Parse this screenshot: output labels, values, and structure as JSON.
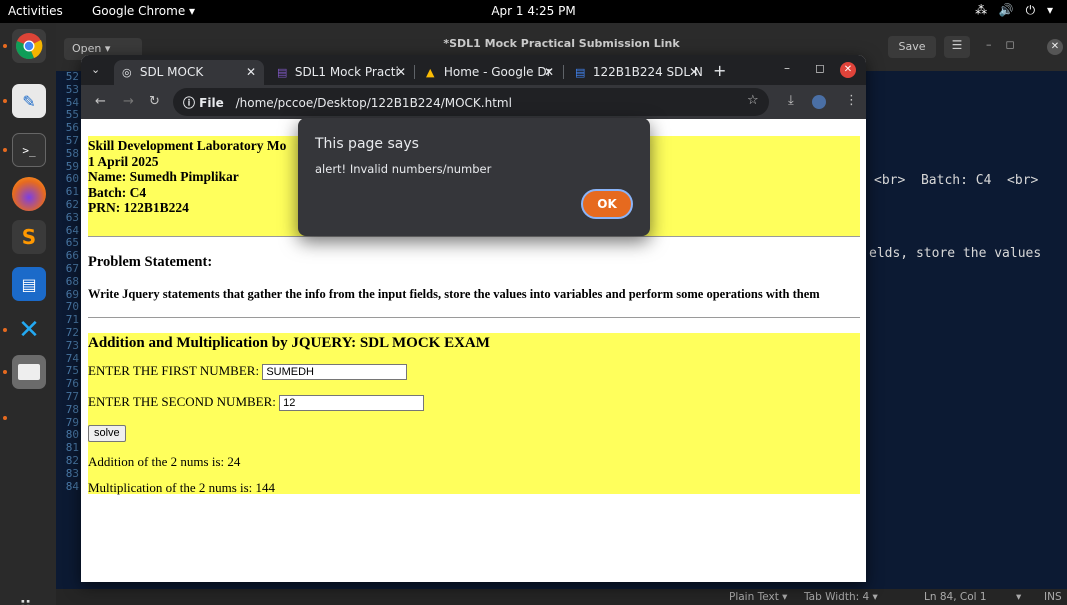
{
  "topbar": {
    "activities": "Activities",
    "app_menu": "Google Chrome ▾",
    "clock": "Apr 1  4:25 PM",
    "tray": "⁂ 🔊 ⏻ ▾"
  },
  "gedit": {
    "open_label": "Open  ▾",
    "title": "*SDL1 Mock Practical Submission Link",
    "save_label": "Save",
    "line_numbers": "52\n53\n54\n55\n56\n57\n58\n59\n60\n61\n62\n63\n64\n65\n66\n67\n68\n69\n70\n71\n72\n73\n74\n75\n76\n77\n78\n79\n80\n81\n82\n83\n84",
    "code_fragment_1": "<br>  Batch: C4  <br>",
    "code_fragment_2": "elds, store the values",
    "status": {
      "lang": "Plain Text ▾",
      "tab_width": "Tab Width: 4 ▾",
      "position": "Ln 84, Col 1",
      "mode": "INS"
    }
  },
  "chrome": {
    "tabs": [
      {
        "label": "SDL MOCK",
        "icon": "globe-icon"
      },
      {
        "label": "SDL1 Mock Practi",
        "icon": "forms-icon"
      },
      {
        "label": "Home - Google Dr",
        "icon": "drive-icon"
      },
      {
        "label": "122B1B224 SDL N",
        "icon": "docs-icon"
      }
    ],
    "omnibox": {
      "scheme": "ⓘ File",
      "path": "/home/pccoe/Desktop/122B1B224/MOCK.html"
    }
  },
  "page": {
    "header": {
      "line1": "Skill Development Laboratory Mo",
      "line2": "1 April 2025",
      "line3": "Name: Sumedh Pimplikar",
      "line4": "Batch: C4",
      "line5": "PRN: 122B1B224"
    },
    "problem_title": "Problem Statement:",
    "problem_text": "Write Jquery statements that gather the info from the input fields, store the values into variables and perform some operations with them",
    "calc": {
      "title": "Addition and Multiplication by JQUERY: SDL MOCK EXAM",
      "first_label": "ENTER THE FIRST NUMBER:",
      "first_value": "SUMEDH",
      "second_label": "ENTER THE SECOND NUMBER:",
      "second_value": "12",
      "solve_label": "solve",
      "addition_result": "Addition of the 2 nums is: 24",
      "multiplication_result": "Multiplication of the 2 nums is: 144"
    }
  },
  "dialog": {
    "title": "This page says",
    "message": "alert! Invalid numbers/number",
    "ok_label": "OK"
  },
  "colors": {
    "highlight_yellow": "#ffff5c",
    "ok_button": "#e66a1f",
    "chrome_dark": "#202124",
    "gedit_bg": "#0c1a33"
  }
}
